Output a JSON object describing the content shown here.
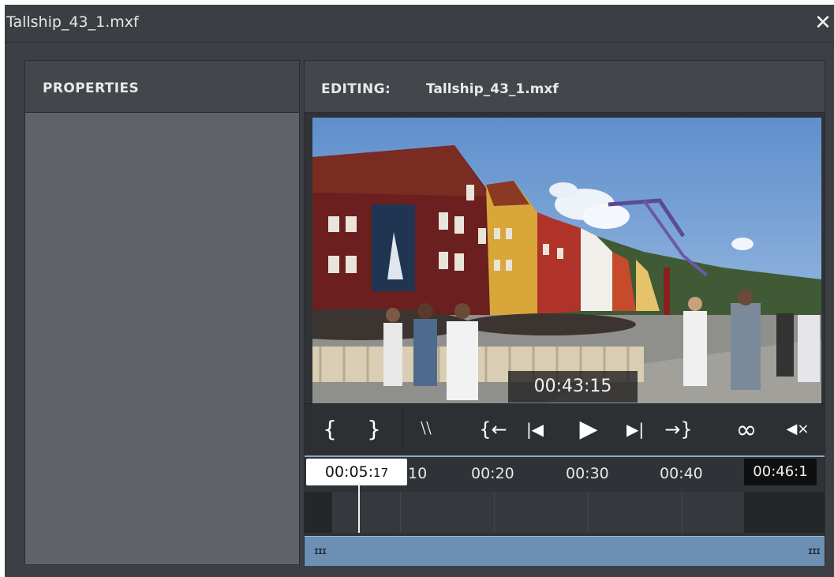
{
  "window": {
    "title": "Tallship_43_1.mxf",
    "close_glyph": "✕"
  },
  "properties_panel": {
    "header": "PROPERTIES"
  },
  "editor_panel": {
    "header_label": "EDITING:",
    "file_name": "Tallship_43_1.mxf",
    "video_timecode": "00:43:15"
  },
  "controls": {
    "mark_in": "{",
    "mark_out": "}",
    "clear_marks": "⧵⧵",
    "go_to_in": "{←",
    "step_back": "|◀",
    "play": "▶",
    "step_forward": "▶|",
    "go_to_out": "→}",
    "loop": "∞",
    "mute": "◀×"
  },
  "ruler": {
    "playhead_main": "00:05:",
    "playhead_frames": "17",
    "ticks": [
      "10",
      "00:20",
      "00:30",
      "00:40"
    ],
    "end_time": "00:46:1"
  },
  "scrollbar": {
    "left_grip": "III",
    "right_grip": "III"
  },
  "colors": {
    "accent": "#6d8fb3",
    "panel_bg": "#5f6367",
    "dark_bg": "#2f3236"
  }
}
